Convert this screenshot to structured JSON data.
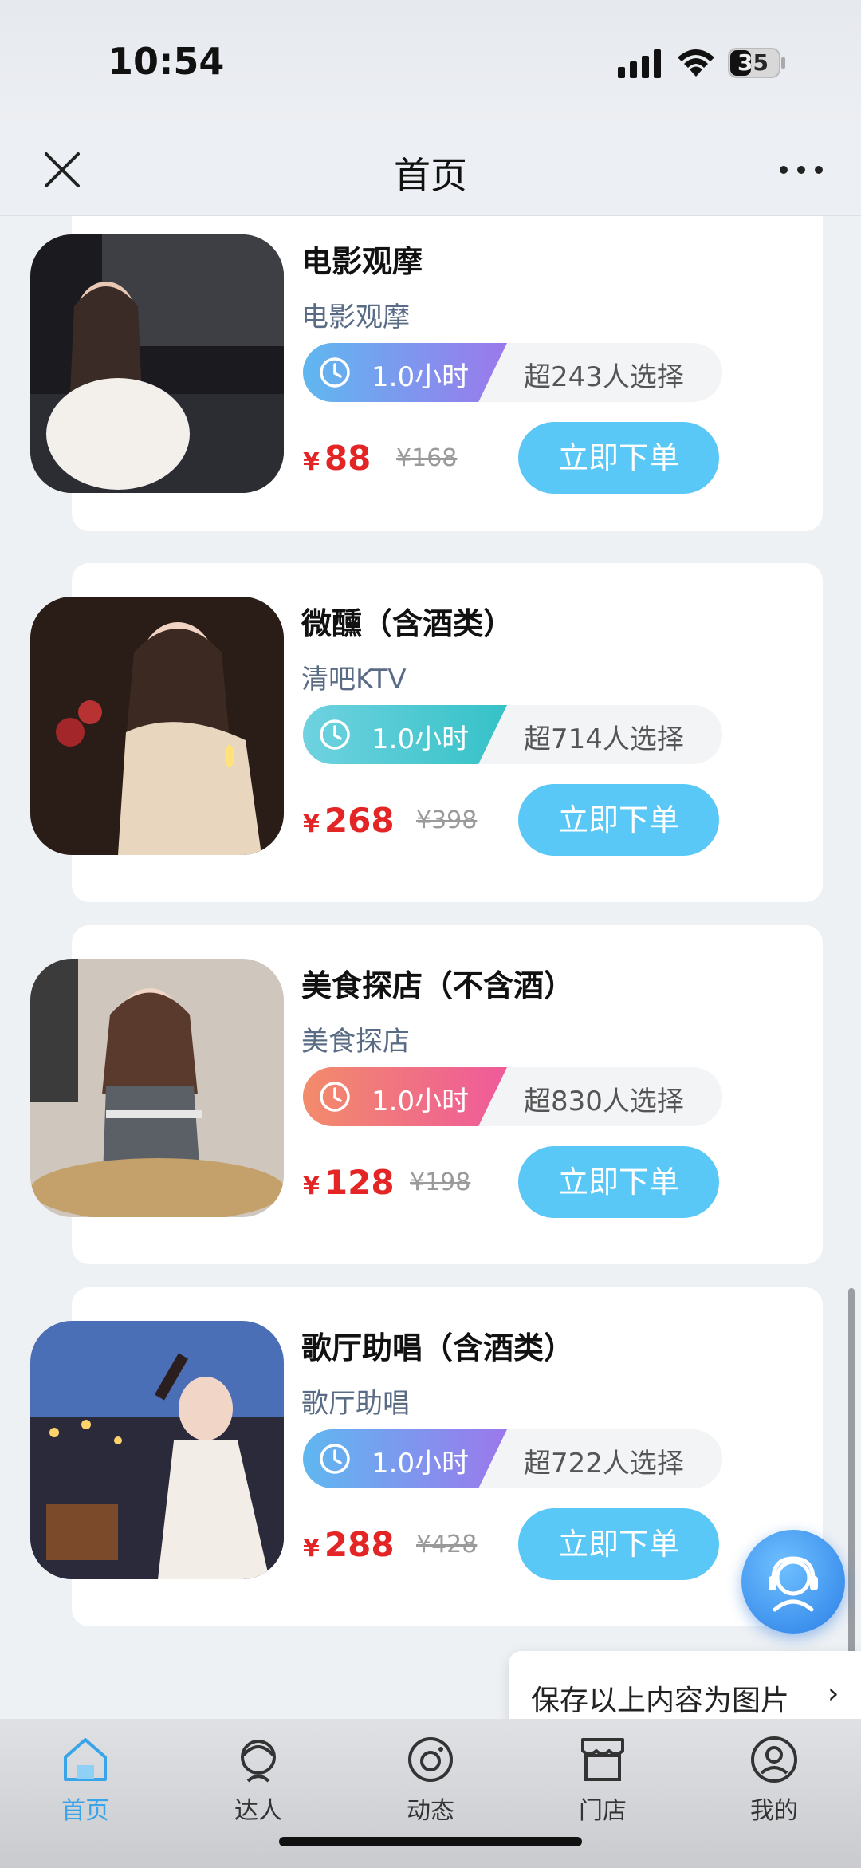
{
  "status_bar": {
    "time": "10:54",
    "battery": "35"
  },
  "nav": {
    "title": "首页"
  },
  "products": [
    {
      "title": "电影观摩",
      "category": "电影观摩",
      "duration": "1.0小时",
      "buyers": "超243人选择",
      "currency": "¥",
      "price": "88",
      "original_price": "¥168",
      "button": "立即下单",
      "badge_color": "#5fb8f0"
    },
    {
      "title": "微醺（含酒类）",
      "category": "清吧KTV",
      "duration": "1.0小时",
      "buyers": "超714人选择",
      "currency": "¥",
      "price": "268",
      "original_price": "¥398",
      "button": "立即下单",
      "badge_color": "#35c2c7"
    },
    {
      "title": "美食探店（不含酒）",
      "category": "美食探店",
      "duration": "1.0小时",
      "buyers": "超830人选择",
      "currency": "¥",
      "price": "128",
      "original_price": "¥198",
      "button": "立即下单",
      "badge_color": "#ef5a9a"
    },
    {
      "title": "歌厅助唱（含酒类）",
      "category": "歌厅助唱",
      "duration": "1.0小时",
      "buyers": "超722人选择",
      "currency": "¥",
      "price": "288",
      "original_price": "¥428",
      "button": "立即下单",
      "badge_color": "#5fb8f0"
    }
  ],
  "save_tip": {
    "label": "保存以上内容为图片",
    "arrow": "›"
  },
  "tabs": [
    {
      "label": "首页",
      "icon": "home-icon",
      "active": true
    },
    {
      "label": "达人",
      "icon": "person-icon",
      "active": false
    },
    {
      "label": "动态",
      "icon": "camera-icon",
      "active": false
    },
    {
      "label": "门店",
      "icon": "store-icon",
      "active": false
    },
    {
      "label": "我的",
      "icon": "profile-icon",
      "active": false
    }
  ],
  "colors": {
    "accent": "#5ac8f6",
    "price": "#e32525",
    "active_tab": "#3aa4e8"
  }
}
